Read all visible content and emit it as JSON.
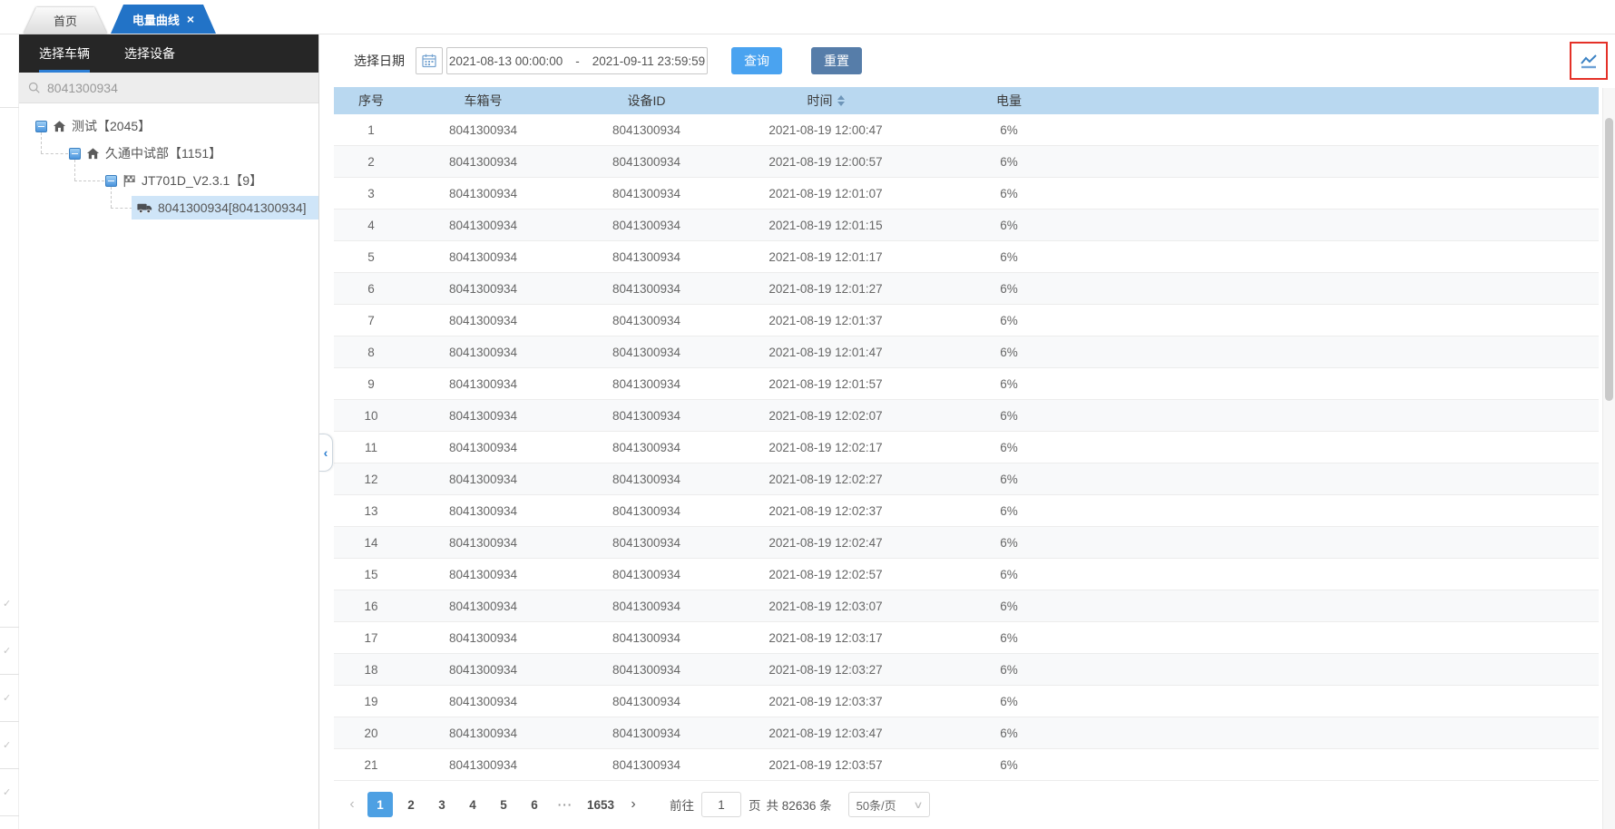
{
  "icons": {
    "close": "×",
    "prev": "‹",
    "next": "›",
    "check": "✓",
    "select_caret": "∨",
    "collapse": "‹"
  },
  "window": {
    "tabs": [
      {
        "label": "首页",
        "active": false
      },
      {
        "label": "电量曲线",
        "active": true
      }
    ]
  },
  "sidebar": {
    "tabs": [
      {
        "label": "选择车辆",
        "active": true
      },
      {
        "label": "选择设备",
        "active": false
      }
    ],
    "search": {
      "value": "8041300934"
    },
    "tree": [
      {
        "label": "测试【2045】",
        "icon": "home"
      },
      {
        "label": "久通中试部【1151】",
        "icon": "home"
      },
      {
        "label": "JT701D_V2.3.1【9】",
        "icon": "flag"
      },
      {
        "label": "8041300934[8041300934]",
        "icon": "truck",
        "selected": true
      }
    ]
  },
  "toolbar": {
    "date_label": "选择日期",
    "date_start": "2021-08-13 00:00:00",
    "date_separator": "-",
    "date_end": "2021-09-11 23:59:59",
    "query_label": "查询",
    "reset_label": "重置"
  },
  "table": {
    "columns": [
      "序号",
      "车箱号",
      "设备ID",
      "时间",
      "电量"
    ],
    "rows": [
      [
        "1",
        "8041300934",
        "8041300934",
        "2021-08-19 12:00:47",
        "6%"
      ],
      [
        "2",
        "8041300934",
        "8041300934",
        "2021-08-19 12:00:57",
        "6%"
      ],
      [
        "3",
        "8041300934",
        "8041300934",
        "2021-08-19 12:01:07",
        "6%"
      ],
      [
        "4",
        "8041300934",
        "8041300934",
        "2021-08-19 12:01:15",
        "6%"
      ],
      [
        "5",
        "8041300934",
        "8041300934",
        "2021-08-19 12:01:17",
        "6%"
      ],
      [
        "6",
        "8041300934",
        "8041300934",
        "2021-08-19 12:01:27",
        "6%"
      ],
      [
        "7",
        "8041300934",
        "8041300934",
        "2021-08-19 12:01:37",
        "6%"
      ],
      [
        "8",
        "8041300934",
        "8041300934",
        "2021-08-19 12:01:47",
        "6%"
      ],
      [
        "9",
        "8041300934",
        "8041300934",
        "2021-08-19 12:01:57",
        "6%"
      ],
      [
        "10",
        "8041300934",
        "8041300934",
        "2021-08-19 12:02:07",
        "6%"
      ],
      [
        "11",
        "8041300934",
        "8041300934",
        "2021-08-19 12:02:17",
        "6%"
      ],
      [
        "12",
        "8041300934",
        "8041300934",
        "2021-08-19 12:02:27",
        "6%"
      ],
      [
        "13",
        "8041300934",
        "8041300934",
        "2021-08-19 12:02:37",
        "6%"
      ],
      [
        "14",
        "8041300934",
        "8041300934",
        "2021-08-19 12:02:47",
        "6%"
      ],
      [
        "15",
        "8041300934",
        "8041300934",
        "2021-08-19 12:02:57",
        "6%"
      ],
      [
        "16",
        "8041300934",
        "8041300934",
        "2021-08-19 12:03:07",
        "6%"
      ],
      [
        "17",
        "8041300934",
        "8041300934",
        "2021-08-19 12:03:17",
        "6%"
      ],
      [
        "18",
        "8041300934",
        "8041300934",
        "2021-08-19 12:03:27",
        "6%"
      ],
      [
        "19",
        "8041300934",
        "8041300934",
        "2021-08-19 12:03:37",
        "6%"
      ],
      [
        "20",
        "8041300934",
        "8041300934",
        "2021-08-19 12:03:47",
        "6%"
      ],
      [
        "21",
        "8041300934",
        "8041300934",
        "2021-08-19 12:03:57",
        "6%"
      ]
    ]
  },
  "pagination": {
    "pages": [
      "1",
      "2",
      "3",
      "4",
      "5",
      "6",
      "···",
      "1653"
    ],
    "active_page": "1",
    "goto_label": "前往",
    "goto_value": "1",
    "page_unit": "页",
    "total_text": "共 82636 条",
    "page_size": "50条/页"
  },
  "colors": {
    "accent_blue": "#2273c7",
    "table_header_bg": "#b9d8f0",
    "query_button": "#4aa3f0",
    "reset_button": "#567da9",
    "active_page_bg": "#4da0e3",
    "selected_node_bg": "#cfe5f8",
    "highlight_border": "#e43128"
  }
}
